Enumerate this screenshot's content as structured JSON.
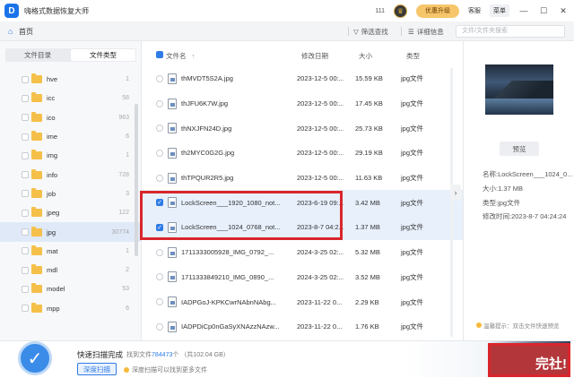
{
  "window": {
    "title": "嗨格式数据恢复大师",
    "count": "111",
    "upgrade_label": "优惠升级",
    "service_label": "客服",
    "menu_label": "菜单"
  },
  "tabbar": {
    "home_label": "首页",
    "filter_label": "筛选查找",
    "detail_label": "详细信息",
    "search_placeholder": "文件/文件夹搜索"
  },
  "left": {
    "tabs": [
      "文件目录",
      "文件类型"
    ],
    "active_tab": "文件类型",
    "folders": [
      {
        "name": "hve",
        "count": "1"
      },
      {
        "name": "icc",
        "count": "58"
      },
      {
        "name": "ico",
        "count": "963"
      },
      {
        "name": "ime",
        "count": "6"
      },
      {
        "name": "img",
        "count": "1"
      },
      {
        "name": "info",
        "count": "728"
      },
      {
        "name": "job",
        "count": "3"
      },
      {
        "name": "jpeg",
        "count": "122"
      },
      {
        "name": "jpg",
        "count": "30774"
      },
      {
        "name": "mat",
        "count": "1"
      },
      {
        "name": "mdl",
        "count": "2"
      },
      {
        "name": "model",
        "count": "53"
      },
      {
        "name": "mpp",
        "count": "6"
      }
    ],
    "selected_folder": "jpg"
  },
  "filelist": {
    "headers": {
      "name": "文件名",
      "date": "修改日期",
      "size": "大小",
      "type": "类型"
    },
    "rows": [
      {
        "name": "thMVDT5S2A.jpg",
        "date": "2023-12-5 00:...",
        "size": "15.59 KB",
        "type": "jpg文件",
        "selected": false
      },
      {
        "name": "thJFU6K7W.jpg",
        "date": "2023-12-5 00:...",
        "size": "17.45 KB",
        "type": "jpg文件",
        "selected": false
      },
      {
        "name": "thNXJFN24D.jpg",
        "date": "2023-12-5 00:...",
        "size": "25.73 KB",
        "type": "jpg文件",
        "selected": false
      },
      {
        "name": "th2MYC0G2G.jpg",
        "date": "2023-12-5 00:...",
        "size": "29.19 KB",
        "type": "jpg文件",
        "selected": false
      },
      {
        "name": "thTPQUR2R5.jpg",
        "date": "2023-12-5 00:...",
        "size": "11.63 KB",
        "type": "jpg文件",
        "selected": false
      },
      {
        "name": "LockScreen___1920_1080_not...",
        "date": "2023-6-19 09:...",
        "size": "3.42 MB",
        "type": "jpg文件",
        "selected": true
      },
      {
        "name": "LockScreen___1024_0768_not...",
        "date": "2023-8-7 04:2...",
        "size": "1.37 MB",
        "type": "jpg文件",
        "selected": true
      },
      {
        "name": "1711333005928_IMG_0792_...",
        "date": "2024-3-25 02:...",
        "size": "5.32 MB",
        "type": "jpg文件",
        "selected": false
      },
      {
        "name": "1711333849210_IMG_0890_...",
        "date": "2024-3-25 02:...",
        "size": "3.52 MB",
        "type": "jpg文件",
        "selected": false
      },
      {
        "name": "IADPGoJ-KPKCwrNAbnNAbg...",
        "date": "2023-11-22 0...",
        "size": "2.29 KB",
        "type": "jpg文件",
        "selected": false
      },
      {
        "name": "IADPDiCp0nGaSyXNAzzNAzw...",
        "date": "2023-11-22 0...",
        "size": "1.76 KB",
        "type": "jpg文件",
        "selected": false
      }
    ]
  },
  "detail": {
    "preview_label": "预览",
    "name": "名称:LockScreen___1024_0...",
    "size": "大小:1.37 MB",
    "type": "类型:jpg文件",
    "modified": "修改时间:2023-8-7 04:24:24",
    "tip": "温馨提示：双击文件快速预览"
  },
  "bottom": {
    "scan_title": "快速扫描完成",
    "found_prefix": "找到文件",
    "found_count": "784473",
    "found_suffix": "个 （共102.04 GB）",
    "deep_scan_label": "深度扫描",
    "deep_tip": "深度扫描可以找到更多文件",
    "recover_label": "完社!"
  },
  "colors": {
    "accent": "#2f7be6",
    "highlight_border": "#d9262c",
    "upgrade": "#f7c66b",
    "folder": "#f5c04a"
  }
}
